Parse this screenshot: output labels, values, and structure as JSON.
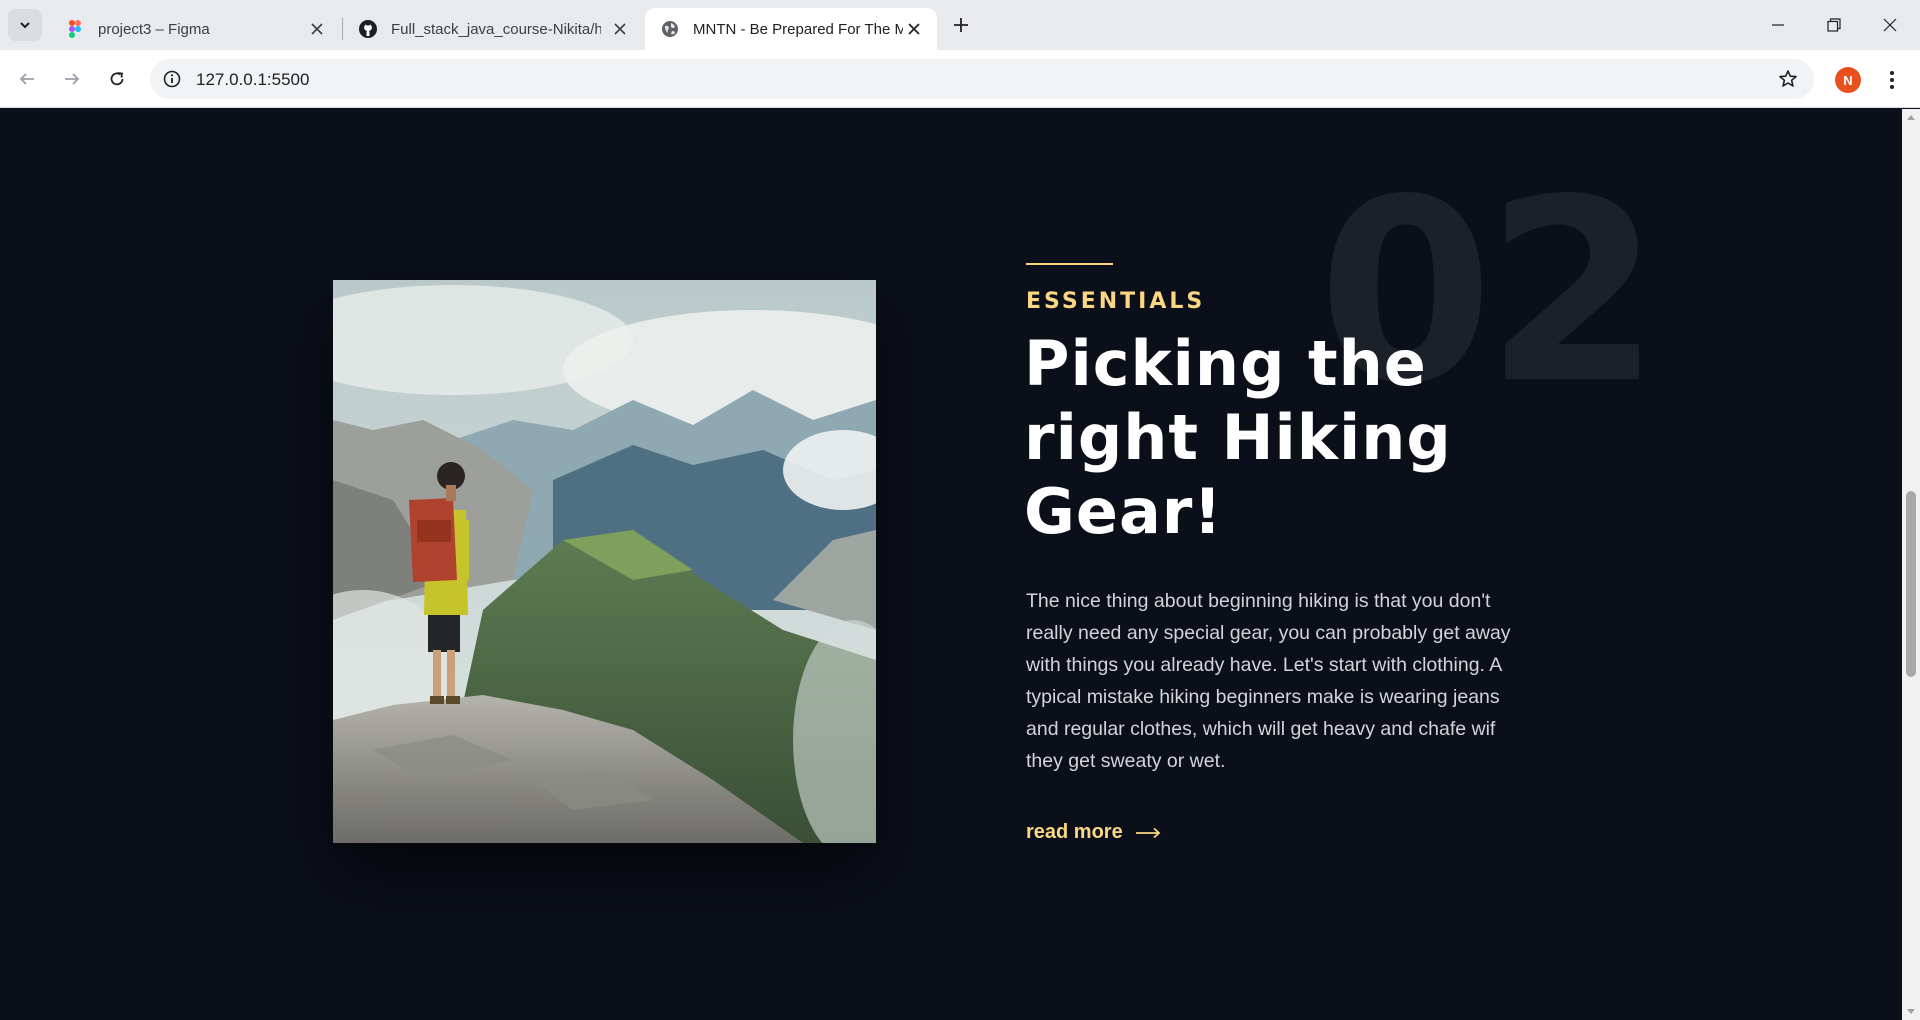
{
  "browser": {
    "tabs": [
      {
        "title": "project3 – Figma",
        "icon": "figma-icon",
        "active": false
      },
      {
        "title": "Full_stack_java_course-Nikita/ht",
        "icon": "github-icon",
        "active": false
      },
      {
        "title": "MNTN - Be Prepared For The M",
        "icon": "globe-icon",
        "active": true
      }
    ],
    "url": "127.0.0.1:5500",
    "profile_initial": "N",
    "profile_color": "#e8501f"
  },
  "section": {
    "number": "02",
    "eyebrow": "ESSENTIALS",
    "heading": "Picking the right Hiking Gear!",
    "body": "The nice thing about beginning hiking is that you don't really need any special gear, you can probably get away with things you already have. Let's start with clothing. A typical mistake hiking beginners make is wearing jeans and regular clothes, which will get heavy and chafe wif they get sweaty or wet.",
    "read_more": "read more",
    "accent_color": "#fbd784",
    "background_color": "#0b0f1a"
  }
}
